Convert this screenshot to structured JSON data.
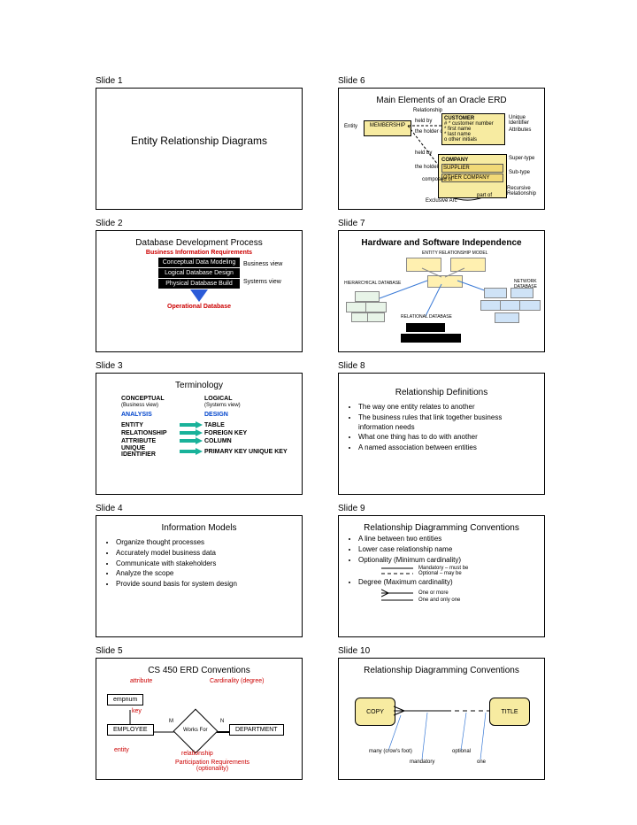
{
  "slides": [
    {
      "label": "Slide 1",
      "title": "Entity Relationship Diagrams"
    },
    {
      "label": "Slide 2",
      "title": "Database Development Process",
      "topLabel": "Business Information Requirements",
      "boxes": [
        "Conceptual Data Modeling",
        "Logical Database Design",
        "Physical Database Build"
      ],
      "sideLabels": [
        "Business view",
        "Systems view"
      ],
      "bottomLabel": "Operational Database"
    },
    {
      "label": "Slide 3",
      "title": "Terminology",
      "headL": "CONCEPTUAL",
      "subL": "(Business view)",
      "headR": "LOGICAL",
      "subR": "(Systems view)",
      "blueL": "ANALYSIS",
      "blueR": "DESIGN",
      "rows": [
        {
          "l": "ENTITY",
          "r": "TABLE"
        },
        {
          "l": "RELATIONSHIP",
          "r": "FOREIGN KEY"
        },
        {
          "l": "ATTRIBUTE",
          "r": "COLUMN"
        },
        {
          "l": "UNIQUE IDENTIFIER",
          "r": "PRIMARY KEY UNIQUE KEY"
        }
      ]
    },
    {
      "label": "Slide 4",
      "title": "Information Models",
      "bullets": [
        "Organize thought processes",
        "Accurately model business data",
        "Communicate with stakeholders",
        "Analyze the scope",
        "Provide sound basis for system design"
      ]
    },
    {
      "label": "Slide 5",
      "title": "CS 450 ERD Conventions",
      "empnum_label": "empnum",
      "attribute_label": "attribute",
      "key_label": "key",
      "cardinality_label": "Cardinality (degree)",
      "m": "M",
      "n": "N",
      "worksfor": "Works For",
      "emp": "EMPLOYEE",
      "dept": "DEPARTMENT",
      "entity_label": "entity",
      "relationship_label": "relationship",
      "participation_label": "Participation Requirements (optionality)"
    },
    {
      "label": "Slide 6",
      "title": "Main Elements of an Oracle ERD",
      "labels": {
        "entity": "Entity",
        "relationship": "Relationship",
        "unique": "Unique Identifier",
        "attributes": "Attributes",
        "super": "Super-type",
        "sub": "Sub-type",
        "recursive": "Recursive Relationship",
        "arc": "Exclusive Arc",
        "heldby": "held by",
        "theholder": "the holder of",
        "composed": "composed of",
        "partof": "part of"
      },
      "membership": "MEMBERSHIP",
      "company": "COMPANY",
      "supplier": "SUPPLIER",
      "other": "OTHER COMPANY",
      "customer": {
        "title": "CUSTOMER",
        "lines": [
          "# * customer number",
          "* first name",
          "* last name",
          "o other initials"
        ]
      }
    },
    {
      "label": "Slide 7",
      "title": "Hardware and Software Independence",
      "labels": {
        "erm": "ENTITY RELATIONSHIP MODEL",
        "hier": "HIERARCHICAL DATABASE",
        "net": "NETWORK DATABASE",
        "rel": "RELATIONAL DATABASE"
      }
    },
    {
      "label": "Slide 8",
      "title": "Relationship Definitions",
      "bullets": [
        "The way one entity relates to another",
        "The business rules that link together business information needs",
        "What one thing has to do with another",
        "A named association between entities"
      ]
    },
    {
      "label": "Slide 9",
      "title": "Relationship Diagramming Conventions",
      "bullets": [
        "A line between two entities",
        "Lower case relationship name",
        "Optionality (Minimum cardinality)"
      ],
      "opt_mand": "Mandatory – must be",
      "opt_opt": "Optional – may be",
      "degree_bullet": "Degree (Maximum cardinality)",
      "deg_many": "One or more",
      "deg_one": "One and only one"
    },
    {
      "label": "Slide 10",
      "title": "Relationship Diagramming Conventions",
      "copy": "COPY",
      "title_box": "TITLE",
      "many": "many (crow's foot)",
      "mandatory": "mandatory",
      "optional": "optional",
      "one": "one"
    }
  ]
}
